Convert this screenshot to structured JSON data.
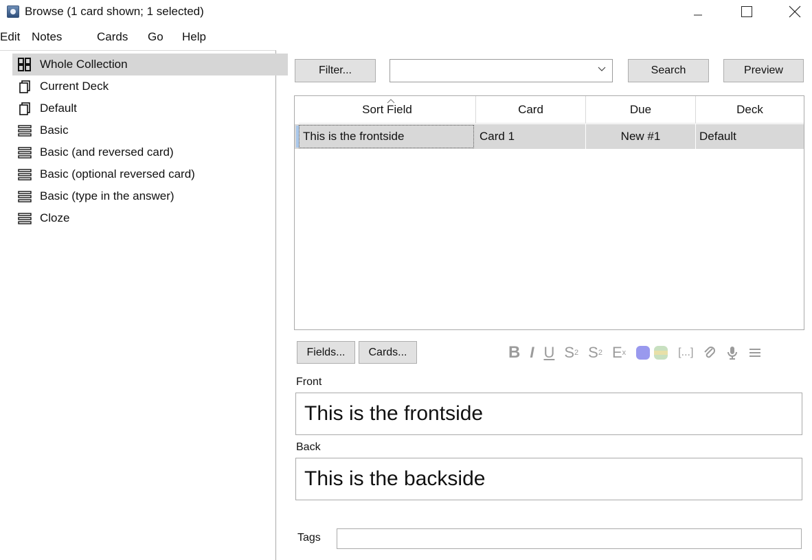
{
  "window": {
    "title": "Browse (1 card shown; 1 selected)"
  },
  "menu": [
    "Edit",
    "Notes",
    "Cards",
    "Go",
    "Help"
  ],
  "sidebar": {
    "items": [
      {
        "label": "Whole Collection",
        "icon": "collection-icon",
        "selected": true
      },
      {
        "label": "Current Deck",
        "icon": "deck-icon"
      },
      {
        "label": "Default",
        "icon": "deck-icon"
      },
      {
        "label": "Basic",
        "icon": "note-type-icon"
      },
      {
        "label": "Basic (and reversed card)",
        "icon": "note-type-icon"
      },
      {
        "label": "Basic (optional reversed card)",
        "icon": "note-type-icon"
      },
      {
        "label": "Basic (type in the answer)",
        "icon": "note-type-icon"
      },
      {
        "label": "Cloze",
        "icon": "note-type-icon"
      }
    ]
  },
  "toolbar": {
    "filter_label": "Filter...",
    "search_value": "",
    "search_label": "Search",
    "preview_label": "Preview"
  },
  "table": {
    "columns": [
      "Sort Field",
      "Card",
      "Due",
      "Deck"
    ],
    "rows": [
      {
        "sort_field": "This is the frontside",
        "card": "Card 1",
        "due": "New #1",
        "deck": "Default"
      }
    ]
  },
  "editor": {
    "fields_button": "Fields...",
    "cards_button": "Cards...",
    "fields": [
      {
        "label": "Front",
        "value": "This is the frontside"
      },
      {
        "label": "Back",
        "value": "This is the backside"
      }
    ],
    "tags_label": "Tags",
    "tags_value": ""
  },
  "colors": {
    "selection": "#d6d6d6",
    "row_selected": "#d8d8d8",
    "toolbar_icon": "#9b9b9b",
    "color_swatch_1": "#9999ee",
    "color_swatch_2": "#c8e0c0"
  }
}
